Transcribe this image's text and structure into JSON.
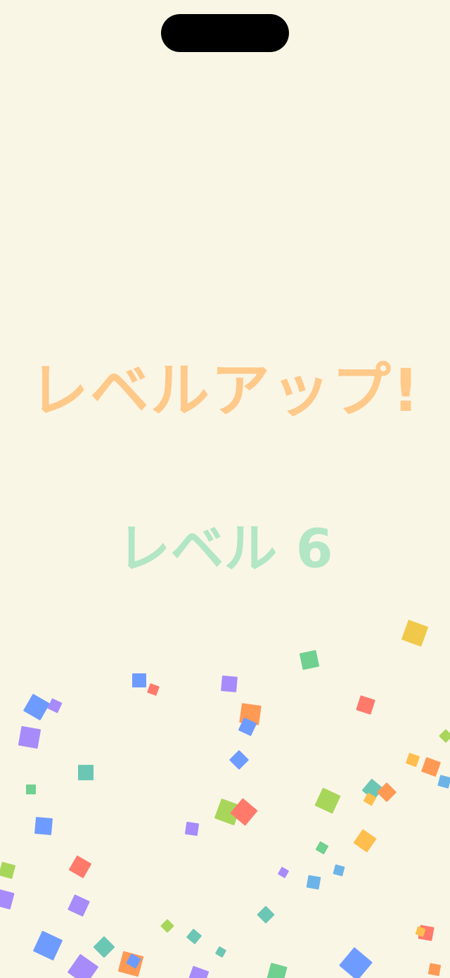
{
  "celebration": {
    "title": "レベルアップ!",
    "level_text": "レベル 6"
  },
  "colors": {
    "background": "#faf6e6",
    "title": "#ffc98a",
    "level": "#b2e6c4",
    "confetti_palette": [
      "#6e9bff",
      "#a78bfa",
      "#ff7a6b",
      "#ff9a55",
      "#f0c94a",
      "#6fd08f",
      "#6cc6b4",
      "#a8d65a",
      "#ffbe4d",
      "#6cb4e8"
    ]
  }
}
